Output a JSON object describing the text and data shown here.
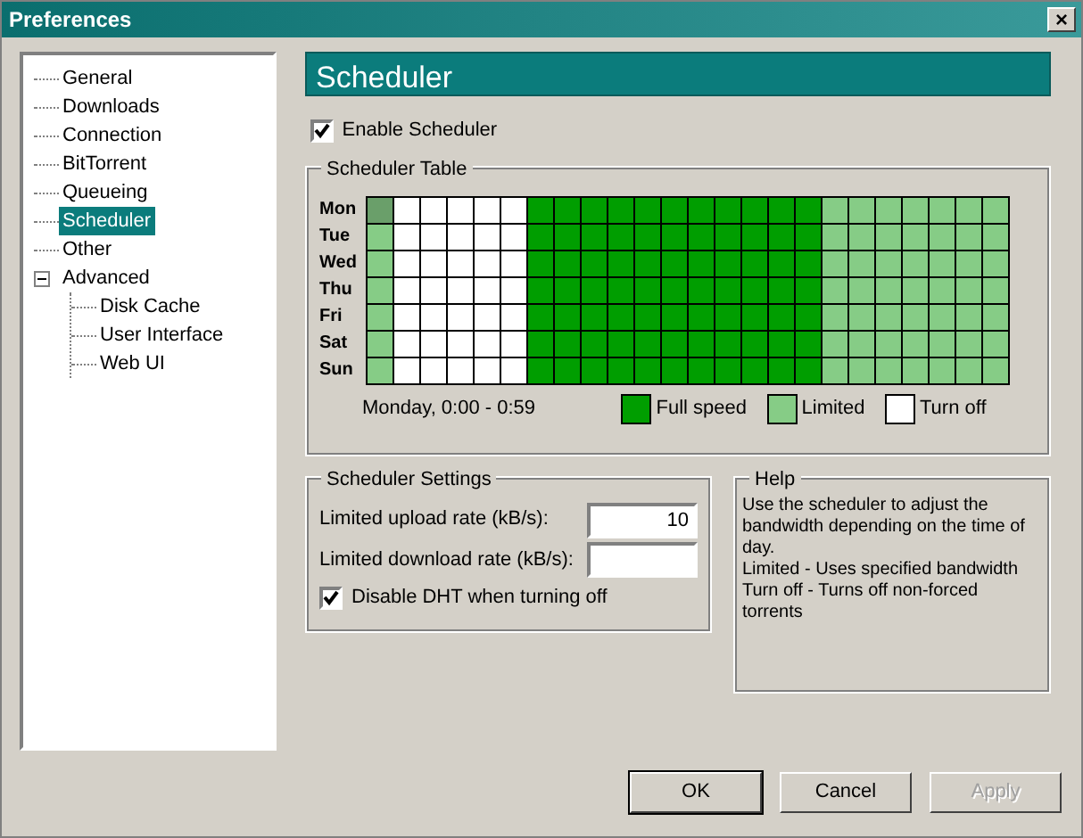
{
  "window": {
    "title": "Preferences",
    "close": "×"
  },
  "tree": [
    {
      "label": "General",
      "selected": false
    },
    {
      "label": "Downloads",
      "selected": false
    },
    {
      "label": "Connection",
      "selected": false
    },
    {
      "label": "BitTorrent",
      "selected": false
    },
    {
      "label": "Queueing",
      "selected": false
    },
    {
      "label": "Scheduler",
      "selected": true
    },
    {
      "label": "Other",
      "selected": false
    },
    {
      "label": "Advanced",
      "selected": false,
      "expanded": true,
      "children": [
        {
          "label": "Disk Cache",
          "selected": false
        },
        {
          "label": "User Interface",
          "selected": false
        },
        {
          "label": "Web UI",
          "selected": false
        }
      ]
    }
  ],
  "page_title": "Scheduler",
  "enable_scheduler": {
    "label": "Enable Scheduler",
    "checked": true
  },
  "scheduler_table": {
    "title": "Scheduler Table",
    "days": [
      {
        "label": "Mon",
        "slots": [
          {
            "kind": "limited",
            "selected": true
          },
          {
            "kind": "off",
            "selected": false
          },
          {
            "kind": "off",
            "selected": false
          },
          {
            "kind": "off",
            "selected": false
          },
          {
            "kind": "off",
            "selected": false
          },
          {
            "kind": "off",
            "selected": false
          },
          {
            "kind": "full",
            "selected": false
          },
          {
            "kind": "full",
            "selected": false
          },
          {
            "kind": "full",
            "selected": false
          },
          {
            "kind": "full",
            "selected": false
          },
          {
            "kind": "full",
            "selected": false
          },
          {
            "kind": "full",
            "selected": false
          },
          {
            "kind": "full",
            "selected": false
          },
          {
            "kind": "full",
            "selected": false
          },
          {
            "kind": "full",
            "selected": false
          },
          {
            "kind": "full",
            "selected": false
          },
          {
            "kind": "full",
            "selected": false
          },
          {
            "kind": "limited",
            "selected": false
          },
          {
            "kind": "limited",
            "selected": false
          },
          {
            "kind": "limited",
            "selected": false
          },
          {
            "kind": "limited",
            "selected": false
          },
          {
            "kind": "limited",
            "selected": false
          },
          {
            "kind": "limited",
            "selected": false
          },
          {
            "kind": "limited",
            "selected": false
          }
        ]
      },
      {
        "label": "Tue",
        "slots": [
          {
            "kind": "limited",
            "selected": false
          },
          {
            "kind": "off",
            "selected": false
          },
          {
            "kind": "off",
            "selected": false
          },
          {
            "kind": "off",
            "selected": false
          },
          {
            "kind": "off",
            "selected": false
          },
          {
            "kind": "off",
            "selected": false
          },
          {
            "kind": "full",
            "selected": false
          },
          {
            "kind": "full",
            "selected": false
          },
          {
            "kind": "full",
            "selected": false
          },
          {
            "kind": "full",
            "selected": false
          },
          {
            "kind": "full",
            "selected": false
          },
          {
            "kind": "full",
            "selected": false
          },
          {
            "kind": "full",
            "selected": false
          },
          {
            "kind": "full",
            "selected": false
          },
          {
            "kind": "full",
            "selected": false
          },
          {
            "kind": "full",
            "selected": false
          },
          {
            "kind": "full",
            "selected": false
          },
          {
            "kind": "limited",
            "selected": false
          },
          {
            "kind": "limited",
            "selected": false
          },
          {
            "kind": "limited",
            "selected": false
          },
          {
            "kind": "limited",
            "selected": false
          },
          {
            "kind": "limited",
            "selected": false
          },
          {
            "kind": "limited",
            "selected": false
          },
          {
            "kind": "limited",
            "selected": false
          }
        ]
      },
      {
        "label": "Wed",
        "slots": [
          {
            "kind": "limited",
            "selected": false
          },
          {
            "kind": "off",
            "selected": false
          },
          {
            "kind": "off",
            "selected": false
          },
          {
            "kind": "off",
            "selected": false
          },
          {
            "kind": "off",
            "selected": false
          },
          {
            "kind": "off",
            "selected": false
          },
          {
            "kind": "full",
            "selected": false
          },
          {
            "kind": "full",
            "selected": false
          },
          {
            "kind": "full",
            "selected": false
          },
          {
            "kind": "full",
            "selected": false
          },
          {
            "kind": "full",
            "selected": false
          },
          {
            "kind": "full",
            "selected": false
          },
          {
            "kind": "full",
            "selected": false
          },
          {
            "kind": "full",
            "selected": false
          },
          {
            "kind": "full",
            "selected": false
          },
          {
            "kind": "full",
            "selected": false
          },
          {
            "kind": "full",
            "selected": false
          },
          {
            "kind": "limited",
            "selected": false
          },
          {
            "kind": "limited",
            "selected": false
          },
          {
            "kind": "limited",
            "selected": false
          },
          {
            "kind": "limited",
            "selected": false
          },
          {
            "kind": "limited",
            "selected": false
          },
          {
            "kind": "limited",
            "selected": false
          },
          {
            "kind": "limited",
            "selected": false
          }
        ]
      },
      {
        "label": "Thu",
        "slots": [
          {
            "kind": "limited",
            "selected": false
          },
          {
            "kind": "off",
            "selected": false
          },
          {
            "kind": "off",
            "selected": false
          },
          {
            "kind": "off",
            "selected": false
          },
          {
            "kind": "off",
            "selected": false
          },
          {
            "kind": "off",
            "selected": false
          },
          {
            "kind": "full",
            "selected": false
          },
          {
            "kind": "full",
            "selected": false
          },
          {
            "kind": "full",
            "selected": false
          },
          {
            "kind": "full",
            "selected": false
          },
          {
            "kind": "full",
            "selected": false
          },
          {
            "kind": "full",
            "selected": false
          },
          {
            "kind": "full",
            "selected": false
          },
          {
            "kind": "full",
            "selected": false
          },
          {
            "kind": "full",
            "selected": false
          },
          {
            "kind": "full",
            "selected": false
          },
          {
            "kind": "full",
            "selected": false
          },
          {
            "kind": "limited",
            "selected": false
          },
          {
            "kind": "limited",
            "selected": false
          },
          {
            "kind": "limited",
            "selected": false
          },
          {
            "kind": "limited",
            "selected": false
          },
          {
            "kind": "limited",
            "selected": false
          },
          {
            "kind": "limited",
            "selected": false
          },
          {
            "kind": "limited",
            "selected": false
          }
        ]
      },
      {
        "label": "Fri",
        "slots": [
          {
            "kind": "limited",
            "selected": false
          },
          {
            "kind": "off",
            "selected": false
          },
          {
            "kind": "off",
            "selected": false
          },
          {
            "kind": "off",
            "selected": false
          },
          {
            "kind": "off",
            "selected": false
          },
          {
            "kind": "off",
            "selected": false
          },
          {
            "kind": "full",
            "selected": false
          },
          {
            "kind": "full",
            "selected": false
          },
          {
            "kind": "full",
            "selected": false
          },
          {
            "kind": "full",
            "selected": false
          },
          {
            "kind": "full",
            "selected": false
          },
          {
            "kind": "full",
            "selected": false
          },
          {
            "kind": "full",
            "selected": false
          },
          {
            "kind": "full",
            "selected": false
          },
          {
            "kind": "full",
            "selected": false
          },
          {
            "kind": "full",
            "selected": false
          },
          {
            "kind": "full",
            "selected": false
          },
          {
            "kind": "limited",
            "selected": false
          },
          {
            "kind": "limited",
            "selected": false
          },
          {
            "kind": "limited",
            "selected": false
          },
          {
            "kind": "limited",
            "selected": false
          },
          {
            "kind": "limited",
            "selected": false
          },
          {
            "kind": "limited",
            "selected": false
          },
          {
            "kind": "limited",
            "selected": false
          }
        ]
      },
      {
        "label": "Sat",
        "slots": [
          {
            "kind": "limited",
            "selected": false
          },
          {
            "kind": "off",
            "selected": false
          },
          {
            "kind": "off",
            "selected": false
          },
          {
            "kind": "off",
            "selected": false
          },
          {
            "kind": "off",
            "selected": false
          },
          {
            "kind": "off",
            "selected": false
          },
          {
            "kind": "full",
            "selected": false
          },
          {
            "kind": "full",
            "selected": false
          },
          {
            "kind": "full",
            "selected": false
          },
          {
            "kind": "full",
            "selected": false
          },
          {
            "kind": "full",
            "selected": false
          },
          {
            "kind": "full",
            "selected": false
          },
          {
            "kind": "full",
            "selected": false
          },
          {
            "kind": "full",
            "selected": false
          },
          {
            "kind": "full",
            "selected": false
          },
          {
            "kind": "full",
            "selected": false
          },
          {
            "kind": "full",
            "selected": false
          },
          {
            "kind": "limited",
            "selected": false
          },
          {
            "kind": "limited",
            "selected": false
          },
          {
            "kind": "limited",
            "selected": false
          },
          {
            "kind": "limited",
            "selected": false
          },
          {
            "kind": "limited",
            "selected": false
          },
          {
            "kind": "limited",
            "selected": false
          },
          {
            "kind": "limited",
            "selected": false
          }
        ]
      },
      {
        "label": "Sun",
        "slots": [
          {
            "kind": "limited",
            "selected": false
          },
          {
            "kind": "off",
            "selected": false
          },
          {
            "kind": "off",
            "selected": false
          },
          {
            "kind": "off",
            "selected": false
          },
          {
            "kind": "off",
            "selected": false
          },
          {
            "kind": "off",
            "selected": false
          },
          {
            "kind": "full",
            "selected": false
          },
          {
            "kind": "full",
            "selected": false
          },
          {
            "kind": "full",
            "selected": false
          },
          {
            "kind": "full",
            "selected": false
          },
          {
            "kind": "full",
            "selected": false
          },
          {
            "kind": "full",
            "selected": false
          },
          {
            "kind": "full",
            "selected": false
          },
          {
            "kind": "full",
            "selected": false
          },
          {
            "kind": "full",
            "selected": false
          },
          {
            "kind": "full",
            "selected": false
          },
          {
            "kind": "full",
            "selected": false
          },
          {
            "kind": "limited",
            "selected": false
          },
          {
            "kind": "limited",
            "selected": false
          },
          {
            "kind": "limited",
            "selected": false
          },
          {
            "kind": "limited",
            "selected": false
          },
          {
            "kind": "limited",
            "selected": false
          },
          {
            "kind": "limited",
            "selected": false
          },
          {
            "kind": "limited",
            "selected": false
          }
        ]
      }
    ],
    "status": "Monday, 0:00 - 0:59",
    "legend": [
      {
        "kind": "full",
        "label": "Full speed"
      },
      {
        "kind": "limited",
        "label": "Limited"
      },
      {
        "kind": "off",
        "label": "Turn off"
      }
    ]
  },
  "scheduler_settings": {
    "title": "Scheduler Settings",
    "fields": [
      {
        "label": "Limited upload rate (kB/s):",
        "value": "10"
      },
      {
        "label": "Limited download rate (kB/s):"
      }
    ],
    "disable_dht": {
      "label": "Disable DHT when turning off",
      "checked": true
    }
  },
  "help": {
    "title": "Help",
    "lines": [
      "Use the scheduler to adjust the bandwidth depending on the time of day.",
      "Limited - Uses specified bandwidth",
      "Turn off - Turns off non-forced torrents"
    ]
  },
  "buttons": [
    {
      "label": "OK",
      "default": true,
      "disabled": false
    },
    {
      "label": "Cancel",
      "default": false,
      "disabled": false
    },
    {
      "label": "Apply",
      "default": false,
      "disabled": true
    }
  ]
}
